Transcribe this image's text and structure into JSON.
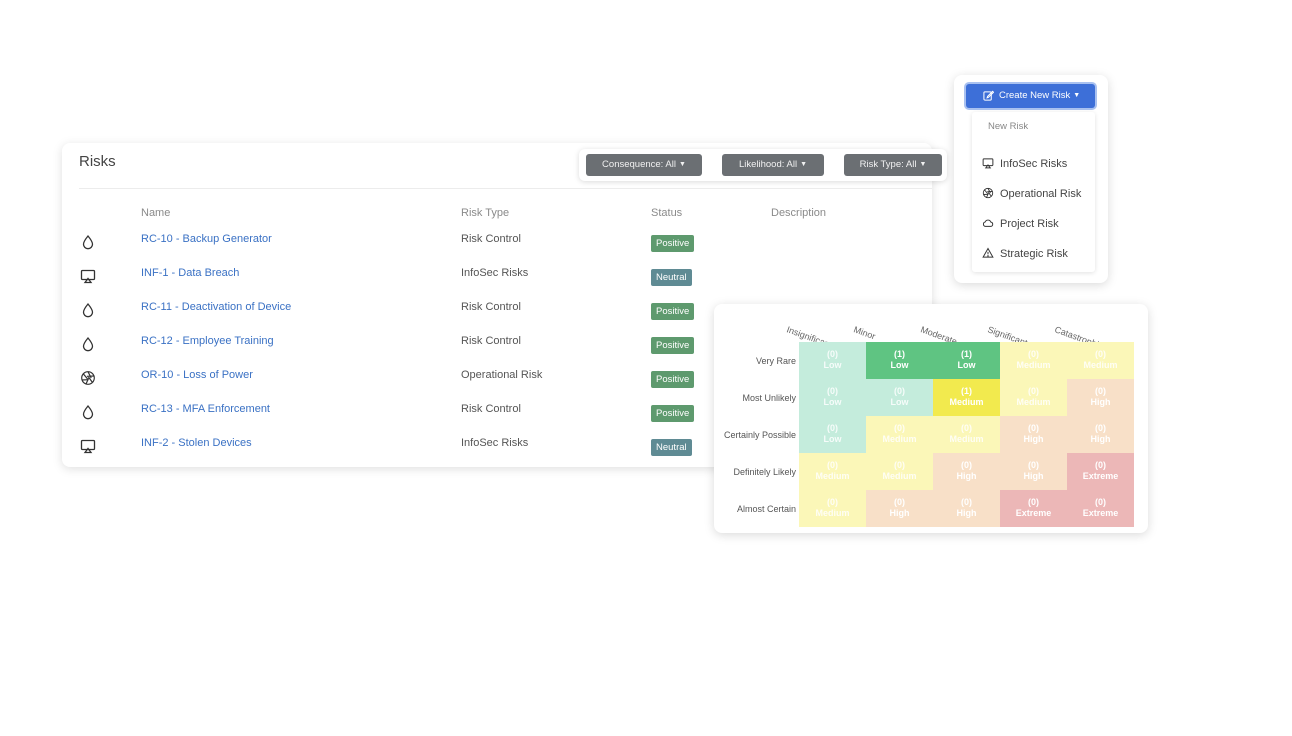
{
  "risks": {
    "title": "Risks",
    "columns": [
      "Name",
      "Risk Type",
      "Status",
      "Description"
    ],
    "rows": [
      {
        "icon": "drop-icon",
        "name": "RC-10 - Backup Generator",
        "type": "Risk Control",
        "status": "Positive"
      },
      {
        "icon": "monitor-icon",
        "name": "INF-1 - Data Breach",
        "type": "InfoSec Risks",
        "status": "Neutral"
      },
      {
        "icon": "drop-icon",
        "name": "RC-11 - Deactivation of Device",
        "type": "Risk Control",
        "status": "Positive"
      },
      {
        "icon": "drop-icon",
        "name": "RC-12 - Employee Training",
        "type": "Risk Control",
        "status": "Positive"
      },
      {
        "icon": "aperture-icon",
        "name": "OR-10 - Loss of Power",
        "type": "Operational Risk",
        "status": "Positive"
      },
      {
        "icon": "drop-icon",
        "name": "RC-13 - MFA Enforcement",
        "type": "Risk Control",
        "status": "Positive"
      },
      {
        "icon": "monitor-icon",
        "name": "INF-2 - Stolen Devices",
        "type": "InfoSec Risks",
        "status": "Neutral"
      }
    ]
  },
  "filters": {
    "consequence": "Consequence: All",
    "likelihood": "Likelihood: All",
    "risk_type": "Risk Type: All"
  },
  "create_menu": {
    "button": "Create New Risk",
    "header": "New Risk",
    "items": [
      {
        "icon": "monitor-icon",
        "label": "InfoSec Risks"
      },
      {
        "icon": "aperture-icon",
        "label": "Operational Risk"
      },
      {
        "icon": "cloud-icon",
        "label": "Project Risk"
      },
      {
        "icon": "warning-icon",
        "label": "Strategic Risk"
      }
    ]
  },
  "heatmap": {
    "columns": [
      "Insignificant",
      "Minor",
      "Moderate",
      "Significant",
      "Catastrophic"
    ],
    "rows": [
      "Very Rare",
      "Most Unlikely",
      "Certainly Possible",
      "Definitely Likely",
      "Almost Certain"
    ],
    "cells": [
      [
        {
          "count": "(0)",
          "level": "Low"
        },
        {
          "count": "(1)",
          "level": "Low"
        },
        {
          "count": "(1)",
          "level": "Low"
        },
        {
          "count": "(0)",
          "level": "Medium"
        },
        {
          "count": "(0)",
          "level": "Medium"
        }
      ],
      [
        {
          "count": "(0)",
          "level": "Low"
        },
        {
          "count": "(0)",
          "level": "Low"
        },
        {
          "count": "(1)",
          "level": "Medium"
        },
        {
          "count": "(0)",
          "level": "Medium"
        },
        {
          "count": "(0)",
          "level": "High"
        }
      ],
      [
        {
          "count": "(0)",
          "level": "Low"
        },
        {
          "count": "(0)",
          "level": "Medium"
        },
        {
          "count": "(0)",
          "level": "Medium"
        },
        {
          "count": "(0)",
          "level": "High"
        },
        {
          "count": "(0)",
          "level": "High"
        }
      ],
      [
        {
          "count": "(0)",
          "level": "Medium"
        },
        {
          "count": "(0)",
          "level": "Medium"
        },
        {
          "count": "(0)",
          "level": "High"
        },
        {
          "count": "(0)",
          "level": "High"
        },
        {
          "count": "(0)",
          "level": "Extreme"
        }
      ],
      [
        {
          "count": "(0)",
          "level": "Medium"
        },
        {
          "count": "(0)",
          "level": "High"
        },
        {
          "count": "(0)",
          "level": "High"
        },
        {
          "count": "(0)",
          "level": "Extreme"
        },
        {
          "count": "(0)",
          "level": "Extreme"
        }
      ]
    ],
    "colors": {
      "Low": "#c4ecdc",
      "Low-active": "#5fc482",
      "Medium": "#fbf7b8",
      "Medium-active": "#f2ea4e",
      "High": "#f8e0c8",
      "Extreme": "#ecb7b7"
    }
  },
  "colors": {
    "accent": "#3d6fd8",
    "link": "#3a71c4",
    "badge_positive": "#5e9a6e",
    "badge_neutral": "#5f8b94",
    "filter_button": "#6b6f73"
  }
}
